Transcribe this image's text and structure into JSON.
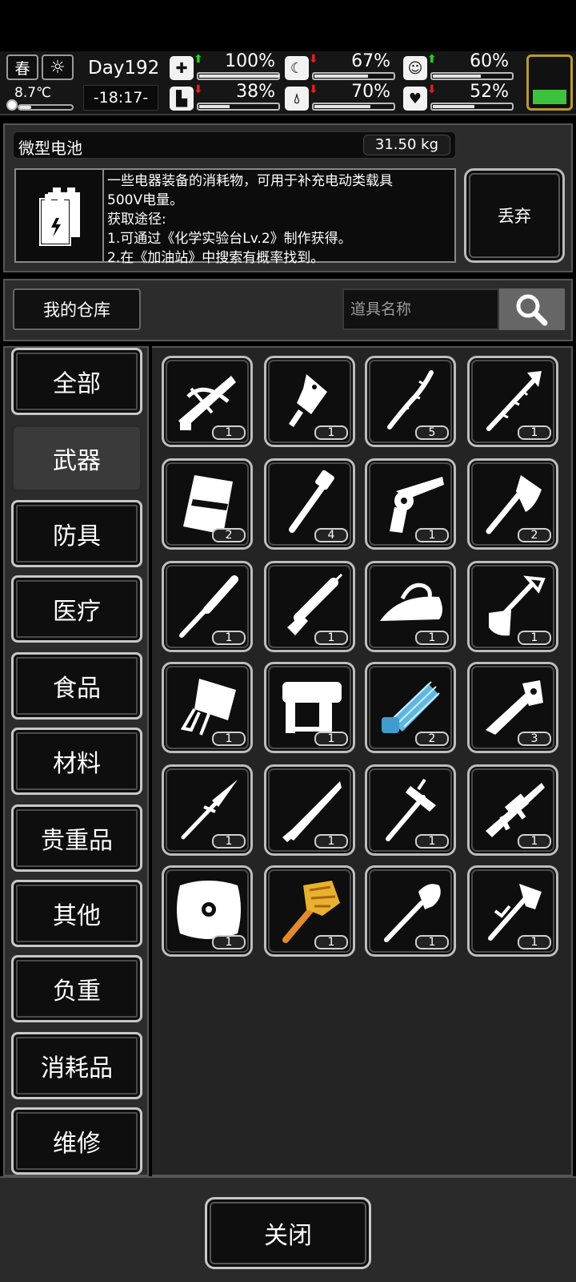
{
  "status": {
    "season": "春",
    "temperature": "8.7℃",
    "temperature_level": 0.22,
    "day": "Day192",
    "time": "-18:17-",
    "stats": [
      {
        "name": "health",
        "icon": "medkit-icon",
        "trend": "up",
        "value": "100%",
        "level": 1.0
      },
      {
        "name": "hunger",
        "icon": "stomach-icon",
        "trend": "down",
        "value": "67%",
        "level": 0.67
      },
      {
        "name": "mood",
        "icon": "face-icon",
        "trend": "up",
        "value": "60%",
        "level": 0.6
      },
      {
        "name": "stamina",
        "icon": "boot-icon",
        "trend": "down",
        "value": "38%",
        "level": 0.38
      },
      {
        "name": "thirst",
        "icon": "drop-icon",
        "trend": "down",
        "value": "70%",
        "level": 0.7
      },
      {
        "name": "heart",
        "icon": "heart-icon",
        "trend": "down",
        "value": "52%",
        "level": 0.52
      }
    ],
    "battery_color": "#3cc23c"
  },
  "item": {
    "name": "微型电池",
    "weight": "31.50 kg",
    "description": [
      "一些电器装备的消耗物，可用于补充电动类载具",
      "500V电量。",
      "获取途径:",
      "1.可通过《化学实验台Lv.2》制作获得。",
      "2.在《加油站》中搜索有概率找到。"
    ],
    "drop_label": "丢弃"
  },
  "warehouse": {
    "tab_label": "我的仓库",
    "search_placeholder": "道具名称"
  },
  "categories": [
    {
      "label": "全部",
      "active": false
    },
    {
      "label": "武器",
      "active": true
    },
    {
      "label": "防具",
      "active": false
    },
    {
      "label": "医疗",
      "active": false
    },
    {
      "label": "食品",
      "active": false
    },
    {
      "label": "材料",
      "active": false
    },
    {
      "label": "贵重品",
      "active": false
    },
    {
      "label": "其他",
      "active": false
    },
    {
      "label": "负重",
      "active": false
    },
    {
      "label": "消耗品",
      "active": false
    },
    {
      "label": "维修",
      "active": false
    }
  ],
  "items": [
    {
      "icon": "crossbow-icon",
      "qty": "1"
    },
    {
      "icon": "cleaver-icon",
      "qty": "1"
    },
    {
      "icon": "wooden-staff-icon",
      "qty": "5"
    },
    {
      "icon": "spiked-staff-icon",
      "qty": "1"
    },
    {
      "icon": "riot-shield-icon",
      "qty": "2"
    },
    {
      "icon": "pipe-wrench-club-icon",
      "qty": "4"
    },
    {
      "icon": "revolver-icon",
      "qty": "1"
    },
    {
      "icon": "axe-icon",
      "qty": "2"
    },
    {
      "icon": "baseball-bat-icon",
      "qty": "1"
    },
    {
      "icon": "caulking-gun-icon",
      "qty": "1"
    },
    {
      "icon": "iron-icon",
      "qty": "1"
    },
    {
      "icon": "shovel-icon",
      "qty": "1"
    },
    {
      "icon": "car-door-icon",
      "qty": "1"
    },
    {
      "icon": "nail-gun-icon",
      "qty": "1"
    },
    {
      "icon": "minigun-icon",
      "qty": "2"
    },
    {
      "icon": "tactical-machete-icon",
      "qty": "3"
    },
    {
      "icon": "spear-icon",
      "qty": "1"
    },
    {
      "icon": "machete-icon",
      "qty": "1"
    },
    {
      "icon": "war-hammer-icon",
      "qty": "1"
    },
    {
      "icon": "assault-rifle-icon",
      "qty": "1"
    },
    {
      "icon": "round-shield-icon",
      "qty": "1"
    },
    {
      "icon": "golden-mace-icon",
      "qty": "1"
    },
    {
      "icon": "spade-icon",
      "qty": "1"
    },
    {
      "icon": "hatchet-icon",
      "qty": "1"
    }
  ],
  "footer": {
    "close_label": "关闭"
  }
}
